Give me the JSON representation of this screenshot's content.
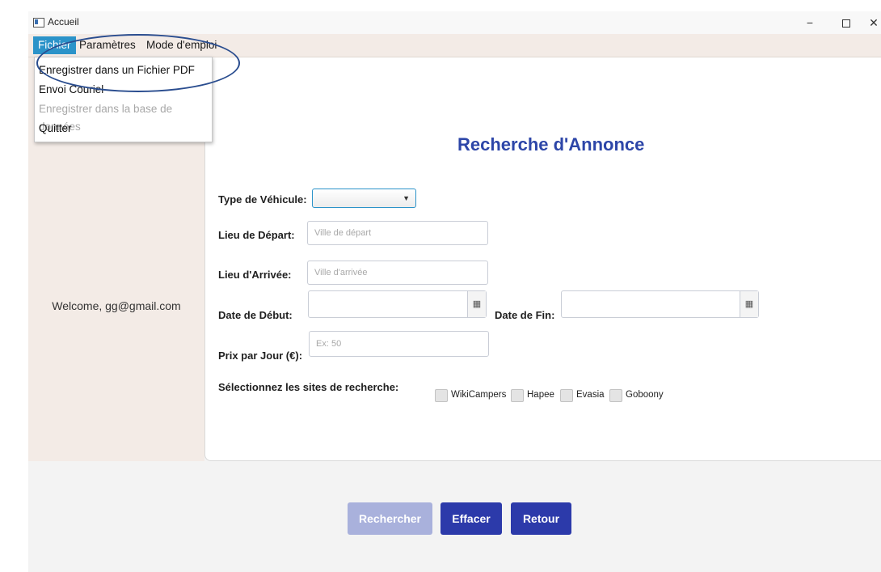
{
  "window": {
    "title": "Accueil",
    "controls": {
      "minimize": "−",
      "close": "✕"
    }
  },
  "menubar": {
    "items": [
      {
        "label": "Fichier",
        "active": true
      },
      {
        "label": "Paramètres"
      },
      {
        "label": "Mode d'emploi"
      }
    ]
  },
  "dropdown": {
    "items": [
      {
        "label": "Enregistrer dans un Fichier PDF",
        "enabled": true
      },
      {
        "label": "Envoi Couriel",
        "enabled": true
      },
      {
        "label": "Enregistrer dans la base de données",
        "enabled": false
      },
      {
        "label": "Quitter",
        "enabled": true
      }
    ]
  },
  "sidebar": {
    "welcome": "Welcome, gg@gmail.com"
  },
  "form": {
    "title": "Recherche d'Annonce",
    "vehicle_type_label": "Type de Véhicule:",
    "vehicle_type_value": "",
    "departure_label": "Lieu de Départ:",
    "departure_placeholder": "Ville de départ",
    "arrival_label": "Lieu d'Arrivée:",
    "arrival_placeholder": "Ville d'arrivée",
    "start_date_label": "Date de Début:",
    "end_date_label": "Date de Fin:",
    "price_label": "Prix par Jour (€):",
    "price_placeholder": "Ex: 50",
    "sites_label": "Sélectionnez les sites de recherche:",
    "sites": [
      {
        "label": "WikiCampers",
        "checked": false
      },
      {
        "label": "Hapee",
        "checked": false
      },
      {
        "label": "Evasia",
        "checked": false
      },
      {
        "label": "Goboony",
        "checked": false
      }
    ]
  },
  "buttons": {
    "search": "Rechercher",
    "clear": "Effacer",
    "back": "Retour"
  },
  "icons": {
    "app": "app-window-icon",
    "calendar": "calendar-icon",
    "dropdown_arrow": "chevron-down-icon"
  },
  "colors": {
    "accent": "#2b93c9",
    "title": "#2d46a8",
    "button_primary": "#2c3aaa",
    "button_disabled": "#a9b1dc",
    "panel": "#f3ebe6",
    "annotation": "#2a4d8f"
  }
}
